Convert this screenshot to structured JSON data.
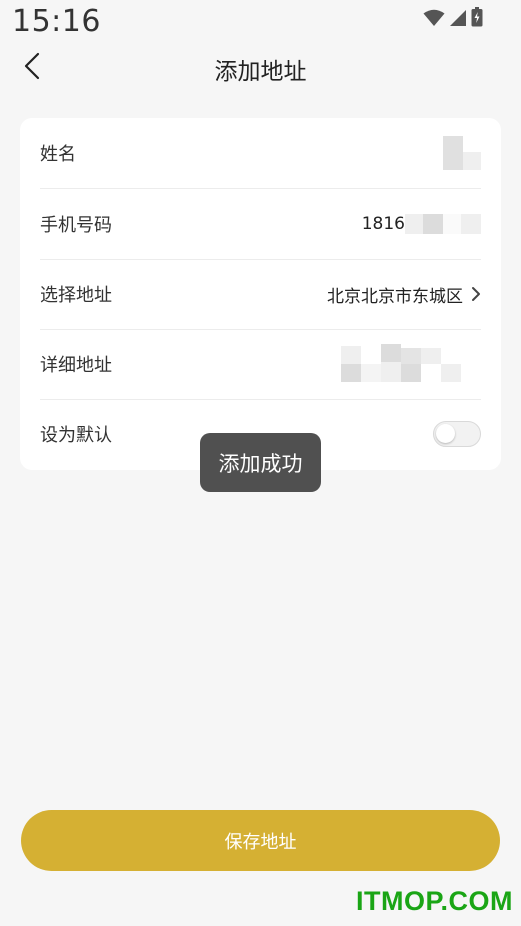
{
  "status_bar": {
    "time": "15:16"
  },
  "nav": {
    "title": "添加地址"
  },
  "form": {
    "rows": [
      {
        "label": "姓名",
        "value": ""
      },
      {
        "label": "手机号码",
        "value": "1816"
      },
      {
        "label": "选择地址",
        "value": "北京北京市东城区"
      },
      {
        "label": "详细地址",
        "value": ""
      },
      {
        "label": "设为默认",
        "toggle_on": false
      }
    ]
  },
  "toast": {
    "text": "添加成功"
  },
  "save_button": {
    "label": "保存地址"
  },
  "watermark": {
    "text": "ITMOP.COM"
  },
  "colors": {
    "accent": "#d5b033",
    "background": "#f6f6f6",
    "toast_bg": "#505050",
    "watermark": "#1aa515"
  }
}
